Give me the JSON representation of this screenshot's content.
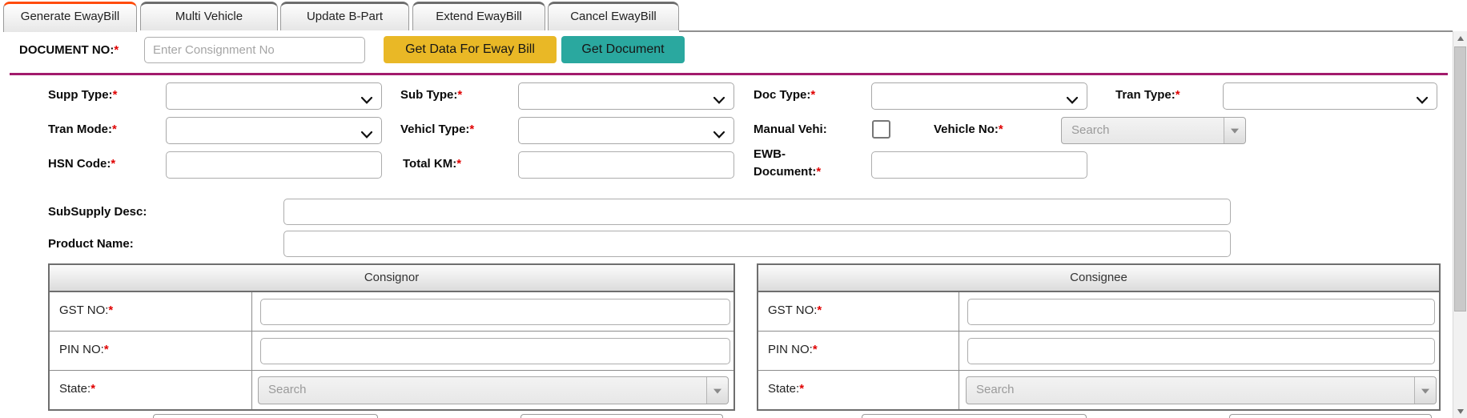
{
  "required_marker": "*",
  "tabs": [
    {
      "label": "Generate EwayBill",
      "active": true
    },
    {
      "label": "Multi Vehicle",
      "active": false
    },
    {
      "label": "Update B-Part",
      "active": false
    },
    {
      "label": "Extend EwayBill",
      "active": false
    },
    {
      "label": "Cancel EwayBill",
      "active": false
    }
  ],
  "document_bar": {
    "label": "DOCUMENT NO:",
    "input_value": "",
    "input_placeholder": "Enter Consignment No",
    "get_data_button": "Get Data For Eway Bill",
    "get_document_button": "Get Document"
  },
  "form": {
    "supp_type": {
      "label": "Supp Type:",
      "required": true,
      "value": ""
    },
    "sub_type": {
      "label": "Sub Type:",
      "required": true,
      "value": ""
    },
    "doc_type": {
      "label": "Doc Type:",
      "required": true,
      "value": ""
    },
    "tran_type": {
      "label": "Tran Type:",
      "required": true,
      "value": ""
    },
    "tran_mode": {
      "label": "Tran Mode:",
      "required": true,
      "value": ""
    },
    "vehicl_type": {
      "label": "Vehicl Type:",
      "required": true,
      "value": ""
    },
    "manual_vehi": {
      "label": "Manual Vehi:",
      "required": false,
      "checked": false
    },
    "vehicle_no": {
      "label": "Vehicle No:",
      "required": true,
      "placeholder": "Search",
      "value": ""
    },
    "hsn_code": {
      "label": "HSN Code:",
      "required": true,
      "value": ""
    },
    "total_km": {
      "label": "Total KM:",
      "required": true,
      "value": ""
    },
    "ewb_document": {
      "label": "EWB-Document:",
      "required": true,
      "value": ""
    },
    "subsupply_desc": {
      "label": "SubSupply Desc:",
      "required": false,
      "value": ""
    },
    "product_name": {
      "label": "Product Name:",
      "required": false,
      "value": ""
    }
  },
  "panels": {
    "consignor": {
      "title": "Consignor",
      "gst_label": "GST NO:",
      "gst_value": "",
      "pin_label": "PIN NO:",
      "pin_value": "",
      "state_label": "State:",
      "state_placeholder": "Search"
    },
    "consignee": {
      "title": "Consignee",
      "gst_label": "GST NO:",
      "gst_value": "",
      "pin_label": "PIN NO:",
      "pin_value": "",
      "state_label": "State:",
      "state_placeholder": "Search"
    }
  },
  "colors": {
    "active_tab_accent": "#ff4b0b",
    "magenta_rule": "#a21b6c",
    "get_data_button_bg": "#e9b826",
    "get_document_button_bg": "#2aa89f"
  }
}
